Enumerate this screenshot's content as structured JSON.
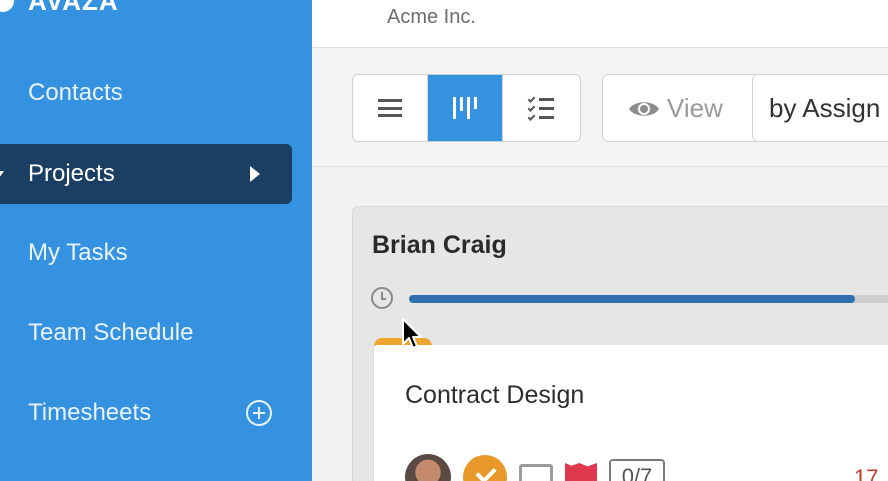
{
  "brand": {
    "name": "AVAZA"
  },
  "sidebar": {
    "items": [
      {
        "label": "Contacts"
      },
      {
        "label": "Projects"
      },
      {
        "label": "My Tasks"
      },
      {
        "label": "Team Schedule"
      },
      {
        "label": "Timesheets"
      }
    ]
  },
  "header": {
    "company": "Acme Inc."
  },
  "toolbar": {
    "view_label": "View",
    "groupby_label": "by Assign"
  },
  "board": {
    "assignee": "Brian Craig",
    "progress": 0.93,
    "card": {
      "title": "Contract Design",
      "subtasks": "0/7",
      "due": "17"
    }
  },
  "colors": {
    "sidebar": "#3592e0",
    "sidebar_active": "#1b3f63",
    "accent": "#3592e0",
    "progress": "#2f6fab",
    "status": "#e9982a",
    "flag": "#e0384c"
  },
  "icons": [
    "search-icon"
  ]
}
